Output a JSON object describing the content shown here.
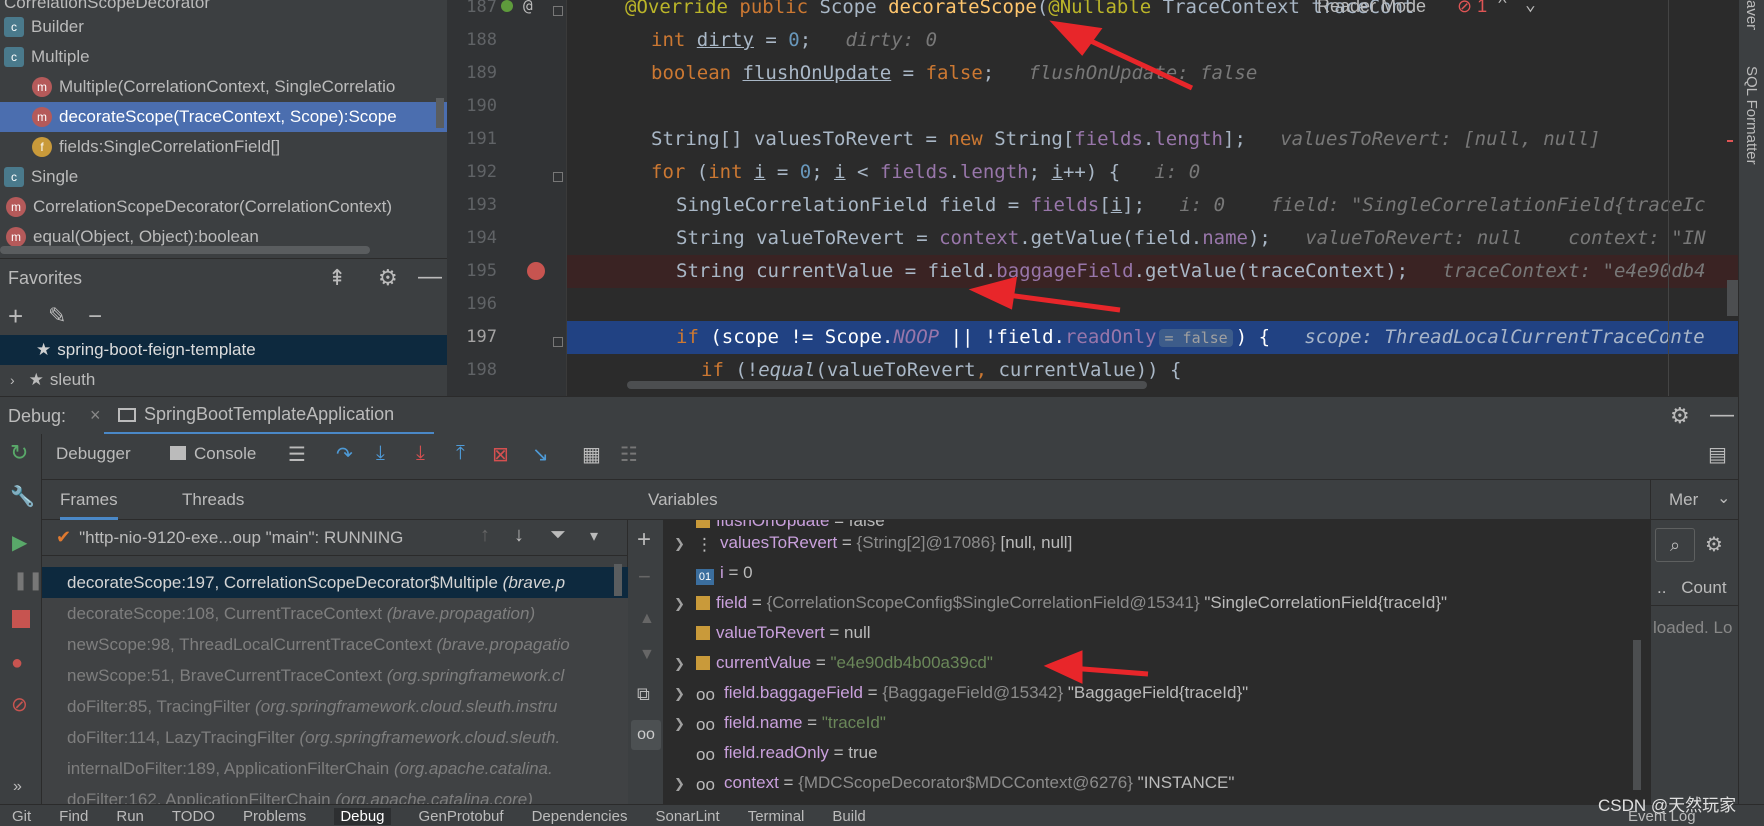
{
  "structure": {
    "items": [
      {
        "label": "CorrelationScopeDecorator",
        "kind": "class"
      },
      {
        "label": "Builder",
        "kind": "class"
      },
      {
        "label": "Multiple",
        "kind": "class"
      },
      {
        "label": "Multiple(CorrelationContext, SingleCorrelatio",
        "kind": "method"
      },
      {
        "label": "decorateScope(TraceContext, Scope):Scope",
        "kind": "method"
      },
      {
        "label": "fields:SingleCorrelationField[]",
        "kind": "field"
      },
      {
        "label": "Single",
        "kind": "class"
      },
      {
        "label": "CorrelationScopeDecorator(CorrelationContext)",
        "kind": "method"
      },
      {
        "label": "equal(Object, Object):boolean",
        "kind": "method"
      }
    ]
  },
  "favorites": {
    "title": "Favorites",
    "items": [
      "spring-boot-feign-template",
      "sleuth"
    ]
  },
  "editor": {
    "reader_mode": "Reader Mode",
    "error_count": "1",
    "right_tool": "SQL Formatter",
    "right_tool_top": "aven",
    "lines": [
      {
        "n": "187",
        "code": "@Override public Scope decorateScope(@Nullable TraceContext traceCont"
      },
      {
        "n": "188",
        "code": "int dirty = 0;",
        "hint": "dirty: 0"
      },
      {
        "n": "189",
        "code": "boolean flushOnUpdate = false;",
        "hint": "flushOnUpdate: false"
      },
      {
        "n": "190",
        "code": ""
      },
      {
        "n": "191",
        "code": "String[] valuesToRevert = new String[fields.length];",
        "hint": "valuesToRevert: [null, null]"
      },
      {
        "n": "192",
        "code": "for (int i = 0; i < fields.length; i++) {",
        "hint": "i: 0"
      },
      {
        "n": "193",
        "code": "SingleCorrelationField field = fields[i];",
        "hint": "i: 0    field: \"SingleCorrelationField{traceIc"
      },
      {
        "n": "194",
        "code": "String valueToRevert = context.getValue(field.name);",
        "hint": "valueToRevert: null    context: \"IN"
      },
      {
        "n": "195",
        "code": "String currentValue = field.baggageField.getValue(traceContext);",
        "hint": "traceContext: \"e4e90db4"
      },
      {
        "n": "196",
        "code": ""
      },
      {
        "n": "197",
        "code": "if (scope != Scope.NOOP || !field.readOnly",
        "inlay": "= false",
        "tail": ") {",
        "hint": "scope: ThreadLocalCurrentTraceConte"
      },
      {
        "n": "198",
        "code": "if (!equal(valueToRevert, currentValue)) {"
      }
    ]
  },
  "debug": {
    "label": "Debug:",
    "config": "SpringBootTemplateApplication",
    "tabs": {
      "debugger": "Debugger",
      "console": "Console"
    },
    "subtabs": {
      "frames": "Frames",
      "threads": "Threads",
      "variables": "Variables",
      "memory": "Mer"
    },
    "thread": "\"http-nio-9120-exe...oup \"main\": RUNNING",
    "frames": [
      {
        "method": "decorateScope:197, CorrelationScopeDecorator$Multiple",
        "pkg": "(brave.p"
      },
      {
        "method": "decorateScope:108, CurrentTraceContext",
        "pkg": "(brave.propagation)"
      },
      {
        "method": "newScope:98, ThreadLocalCurrentTraceContext",
        "pkg": "(brave.propagatio"
      },
      {
        "method": "newScope:51, BraveCurrentTraceContext",
        "pkg": "(org.springframework.cl"
      },
      {
        "method": "doFilter:85, TracingFilter",
        "pkg": "(org.springframework.cloud.sleuth.instru"
      },
      {
        "method": "doFilter:114, LazyTracingFilter",
        "pkg": "(org.springframework.cloud.sleuth."
      },
      {
        "method": "internalDoFilter:189, ApplicationFilterChain",
        "pkg": "(org.apache.catalina."
      },
      {
        "method": "doFilter:162, ApplicationFilterChain",
        "pkg": "(org.apache.catalina.core)"
      }
    ],
    "variables": [
      {
        "name": "flushOnUpdate",
        "eq": " = ",
        "type": "",
        "value": "false",
        "icon": "field",
        "expand": false
      },
      {
        "name": "valuesToRevert",
        "eq": " = ",
        "type": "{String[2]@17086}",
        "value": "[null, null]",
        "icon": "array",
        "expand": true
      },
      {
        "name": "i",
        "eq": " = ",
        "type": "",
        "value": "0",
        "icon": "prim",
        "expand": false
      },
      {
        "name": "field",
        "eq": " = ",
        "type": "{CorrelationScopeConfig$SingleCorrelationField@15341}",
        "value": "\"SingleCorrelationField{traceId}\"",
        "icon": "field",
        "expand": true
      },
      {
        "name": "valueToRevert",
        "eq": " = ",
        "type": "",
        "value": "null",
        "icon": "field",
        "expand": false
      },
      {
        "name": "currentValue",
        "eq": " = ",
        "type": "",
        "value": "\"e4e90db4b00a39cd\"",
        "icon": "field",
        "expand": true,
        "str": true
      },
      {
        "name": "field.baggageField",
        "eq": " = ",
        "type": "{BaggageField@15342}",
        "value": "\"BaggageField{traceId}\"",
        "icon": "watch",
        "expand": true
      },
      {
        "name": "field.name",
        "eq": " = ",
        "type": "",
        "value": "\"traceId\"",
        "icon": "watch",
        "expand": true,
        "str": true
      },
      {
        "name": "field.readOnly",
        "eq": " = ",
        "type": "",
        "value": "true",
        "icon": "watch",
        "expand": false
      },
      {
        "name": "context",
        "eq": " = ",
        "type": "{MDCScopeDecorator$MDCContext@6276}",
        "value": "\"INSTANCE\"",
        "icon": "watch",
        "expand": true
      }
    ],
    "memory": {
      "count": "Count",
      "dots": "..",
      "loaded": "loaded. Lo"
    }
  },
  "statusbar": {
    "items": [
      "Git",
      "Find",
      "Run",
      "TODO",
      "Problems",
      "Debug",
      "GenProtobuf",
      "Dependencies",
      "SonarLint",
      "Terminal",
      "Build"
    ],
    "event_log": "Event Log",
    "watermark": "CSDN @天然玩家"
  },
  "colors": {
    "accent": "#4b6eaf",
    "selection": "#214283",
    "breakpoint": "#c75450",
    "arrow": "#e8262a"
  }
}
